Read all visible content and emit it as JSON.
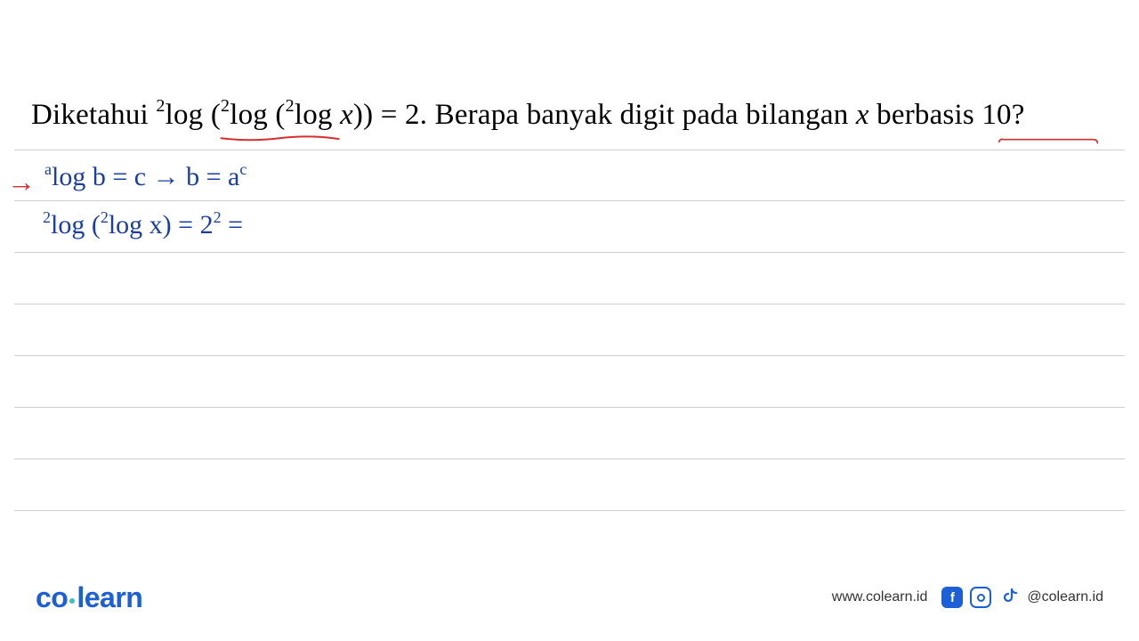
{
  "problem": {
    "prefix": "Diketahui ",
    "sup": "2",
    "log_word": "log",
    "expr_open": " (",
    "expr_mid1": "log (",
    "expr_mid2": "log ",
    "var_x": "x",
    "expr_close": ")) = 2. ",
    "rest": "Berapa banyak digit pada bilangan ",
    "var_x2": "x",
    "tail": " berbasis 10?"
  },
  "handwriting": {
    "rule_line1_a": "a",
    "rule_line1_body": "log b = c  →   b = a",
    "rule_line1_c": "c",
    "line2_sup1": "2",
    "line2_body1": "log (",
    "line2_sup2": "2",
    "line2_body2": "log x)  =  2",
    "line2_sup3": "2",
    "line2_tail": " = "
  },
  "footer": {
    "logo_left": "co",
    "logo_right": "learn",
    "website": "www.colearn.id",
    "handle": "@colearn.id",
    "icons": {
      "facebook": "f",
      "instagram": "instagram-icon",
      "tiktok": "tiktok-icon"
    }
  },
  "colors": {
    "brand": "#1d5fd6",
    "ink": "#1a3fa0",
    "red": "#d62f2f"
  }
}
